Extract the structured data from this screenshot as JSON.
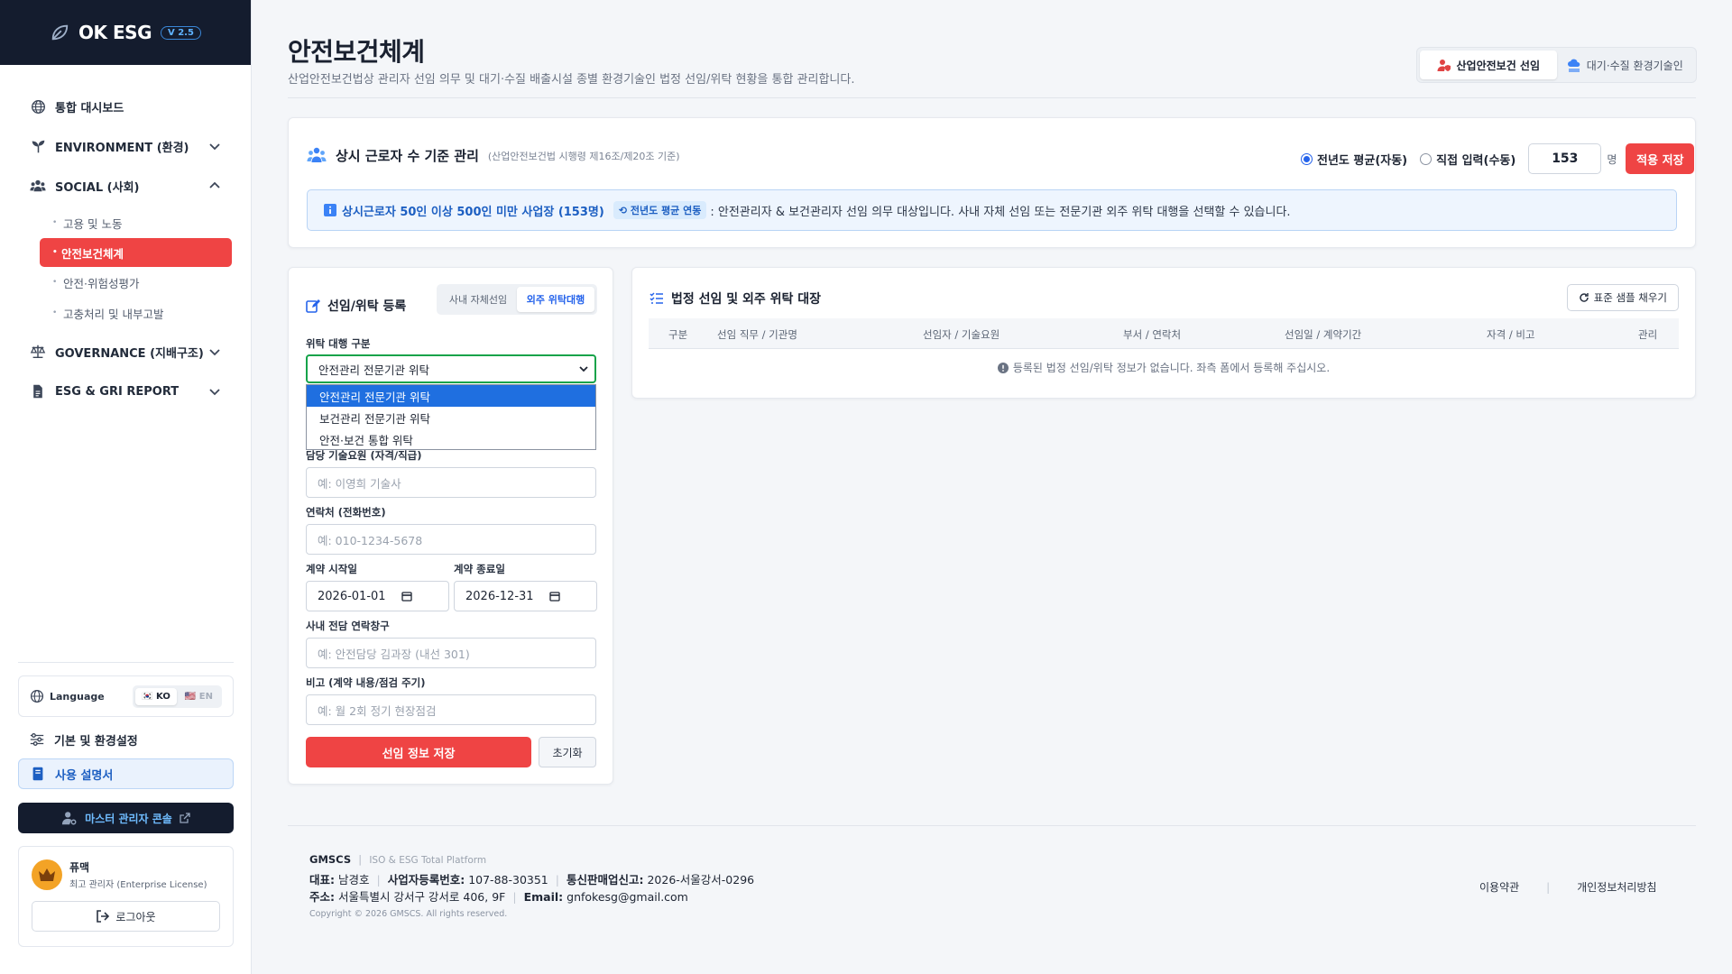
{
  "brand": {
    "name": "OK ESG",
    "version": "V 2.5"
  },
  "sidebar": {
    "items": [
      {
        "label": "통합 대시보드",
        "icon": "globe-icon"
      },
      {
        "label": "ENVIRONMENT (환경)",
        "icon": "sprout-icon"
      },
      {
        "label": "SOCIAL (사회)",
        "icon": "users-icon"
      },
      {
        "label": "GOVERNANCE (지배구조)",
        "icon": "scale-icon"
      },
      {
        "label": "ESG & GRI REPORT",
        "icon": "report-icon"
      }
    ],
    "social_sub": [
      "고용 및 노동",
      "안전보건체계",
      "안전·위험성평가",
      "고충처리 및 내부고발"
    ],
    "active_sub": "안전보건체계"
  },
  "language": {
    "label": "Language",
    "ko": "KO",
    "en": "EN",
    "selected": "KO"
  },
  "settings_label": "기본 및 환경설정",
  "manual_label": "사용 설명서",
  "master_console_label": "마스터 관리자 콘솔",
  "user": {
    "name": "퓨맥",
    "role": "최고 관리자 (Enterprise License)",
    "logout_label": "로그아웃"
  },
  "page": {
    "title": "안전보건체계",
    "subtitle": "산업안전보건법상 관리자 선임 의무 및 대기·수질 배출시설 종별 환경기술인 법정 선임/위탁 현황을 통합 관리합니다.",
    "tabs": [
      {
        "label": "산업안전보건 선임",
        "icon": "user-shield-icon",
        "active": true
      },
      {
        "label": "대기·수질 환경기술인",
        "icon": "cloud-water-icon",
        "active": false
      }
    ]
  },
  "workers": {
    "title": "상시 근로자 수 기준 관리",
    "note": "(산업안전보건법 시행령 제16조/제20조 기준)",
    "radio_auto": "전년도 평균(자동)",
    "radio_manual": "직접 입력(수동)",
    "selected_mode": "auto",
    "count": "153",
    "unit": "명",
    "apply_label": "적용 저장",
    "info_strong": "상시근로자 50인 이상 500인 미만 사업장 (153명)",
    "info_pill": "전년도 평균 연동",
    "info_text": ": 안전관리자 & 보건관리자 선임 의무 대상입니다. 사내 자체 선임 또는 전문기관 외주 위탁 대행을 선택할 수 있습니다."
  },
  "form": {
    "title": "선임/위탁 등록",
    "tab_inhouse": "사내 자체선임",
    "tab_outsource": "외주 위탁대행",
    "active_tab": "outsource",
    "type_label": "위탁 대행 구분",
    "type_value": "안전관리 전문기관 위탁",
    "type_options": [
      "안전관리 전문기관 위탁",
      "보건관리 전문기관 위탁",
      "안전·보건 통합 위탁"
    ],
    "tech_label": "담당 기술요원 (자격/직급)",
    "tech_placeholder": "예: 이영희 기술사",
    "phone_label": "연락처 (전화번호)",
    "phone_placeholder": "예: 010-1234-5678",
    "start_label": "계약 시작일",
    "start_value": "2026-01-01",
    "end_label": "계약 종료일",
    "end_value": "2026-12-31",
    "contact_label": "사내 전담 연락창구",
    "contact_placeholder": "예: 안전담당 김과장 (내선 301)",
    "memo_label": "비고 (계약 내용/점검 주기)",
    "memo_placeholder": "예: 월 2회 정기 현장점검",
    "save_label": "선임 정보 저장",
    "reset_label": "초기화"
  },
  "ledger": {
    "title": "법정 선임 및 외주 위탁 대장",
    "fill_label": "표준 샘플 채우기",
    "columns": [
      "구분",
      "선임 직무 / 기관명",
      "선임자 / 기술요원",
      "부서 / 연락처",
      "선임일 / 계약기간",
      "자격 / 비고",
      "관리"
    ],
    "empty_text": "등록된 법정 선임/위탁 정보가 없습니다. 좌측 폼에서 등록해 주십시오."
  },
  "footer": {
    "brand": "GMSCS",
    "tagline": "ISO & ESG Total Platform",
    "ceo_label": "대표:",
    "ceo": "남경호",
    "biz_label": "사업자등록번호:",
    "biz": "107-88-30351",
    "sales_label": "통신판매업신고:",
    "sales": "2026-서울강서-0296",
    "addr_label": "주소:",
    "addr": "서울특별시 강서구 강서로 406, 9F",
    "email_label": "Email:",
    "email": "gnfokesg@gmail.com",
    "copyright": "Copyright © 2026 GMSCS. All rights reserved.",
    "terms": "이용약관",
    "privacy": "개인정보처리방침"
  },
  "colors": {
    "accent_red": "#ef4444",
    "brand_dark": "#141c2e",
    "primary_blue": "#2563eb"
  }
}
